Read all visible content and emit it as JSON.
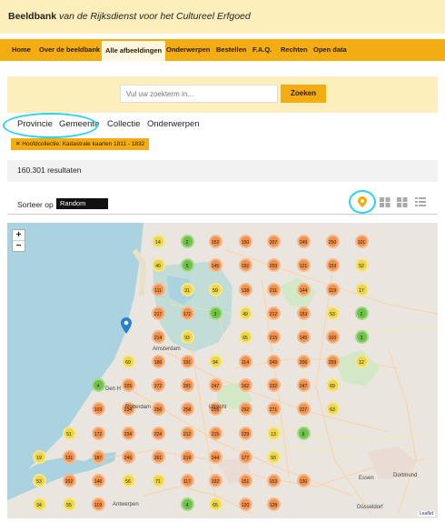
{
  "header": {
    "brand_bold": "Beeldbank",
    "brand_rest": " van de Rijksdienst voor het Cultureel Erfgoed"
  },
  "nav": {
    "items": [
      {
        "label": "Home"
      },
      {
        "label": "Over de beeldbank"
      },
      {
        "label": "Alle afbeeldingen",
        "active": true
      },
      {
        "label": "Onderwerpen"
      },
      {
        "label": "Bestellen"
      },
      {
        "label": "F.A.Q."
      },
      {
        "label": "Rechten"
      },
      {
        "label": "Open data"
      }
    ]
  },
  "search": {
    "placeholder": "Vul uw zoekterm in...",
    "button_label": "Zoeken"
  },
  "facets": [
    "Provincie",
    "Gemeente",
    "Collectie",
    "Onderwerpen"
  ],
  "active_filter": "✕ Hoofdcollectie: Kadastrale kaarten 1811 - 1832",
  "results": {
    "count_text": "160.301 resultaten"
  },
  "sort": {
    "label": "Sorteer op",
    "value": "Random"
  },
  "view_icons": [
    "map-pin-icon",
    "grid-large-icon",
    "grid-small-icon",
    "list-icon"
  ],
  "map": {
    "zoom_in": "+",
    "zoom_out": "−",
    "attribution": "Leaflet",
    "cities": [
      "Amsterdam",
      "Den H",
      "Utrecht",
      "Rotterdam",
      "Antwerpen",
      "Essen",
      "Dortmund",
      "Düsseldorf"
    ],
    "clusters": [
      {
        "label": "14",
        "color": "yellow"
      },
      {
        "label": "2",
        "color": "green"
      },
      {
        "label": "152",
        "color": "orange"
      },
      {
        "label": "150",
        "color": "orange"
      },
      {
        "label": "207",
        "color": "orange"
      },
      {
        "label": "249",
        "color": "orange"
      },
      {
        "label": "250",
        "color": "orange"
      },
      {
        "label": "101",
        "color": "orange"
      },
      {
        "label": "40",
        "color": "yellow"
      },
      {
        "label": "5",
        "color": "green"
      },
      {
        "label": "145",
        "color": "orange"
      },
      {
        "label": "192",
        "color": "orange"
      },
      {
        "label": "203",
        "color": "orange"
      },
      {
        "label": "121",
        "color": "orange"
      },
      {
        "label": "153",
        "color": "orange"
      },
      {
        "label": "52",
        "color": "yellow"
      },
      {
        "label": "111",
        "color": "orange"
      },
      {
        "label": "31",
        "color": "yellow"
      },
      {
        "label": "59",
        "color": "yellow"
      },
      {
        "label": "138",
        "color": "orange"
      },
      {
        "label": "211",
        "color": "orange"
      },
      {
        "label": "144",
        "color": "orange"
      },
      {
        "label": "119",
        "color": "orange"
      },
      {
        "label": "17",
        "color": "yellow"
      },
      {
        "label": "217",
        "color": "orange"
      },
      {
        "label": "172",
        "color": "orange"
      },
      {
        "label": "3",
        "color": "green"
      },
      {
        "label": "49",
        "color": "yellow"
      },
      {
        "label": "212",
        "color": "orange"
      },
      {
        "label": "153",
        "color": "orange"
      },
      {
        "label": "53",
        "color": "yellow"
      },
      {
        "label": "2",
        "color": "green"
      },
      {
        "label": "214",
        "color": "orange"
      },
      {
        "label": "93",
        "color": "yellow"
      },
      {
        "label": "65",
        "color": "yellow"
      },
      {
        "label": "215",
        "color": "orange"
      },
      {
        "label": "145",
        "color": "orange"
      },
      {
        "label": "103",
        "color": "orange"
      },
      {
        "label": "3",
        "color": "green"
      },
      {
        "label": "69",
        "color": "yellow"
      },
      {
        "label": "186",
        "color": "orange"
      },
      {
        "label": "191",
        "color": "orange"
      },
      {
        "label": "94",
        "color": "yellow"
      },
      {
        "label": "114",
        "color": "orange"
      },
      {
        "label": "249",
        "color": "orange"
      },
      {
        "label": "206",
        "color": "orange"
      },
      {
        "label": "259",
        "color": "orange"
      },
      {
        "label": "12",
        "color": "yellow"
      },
      {
        "label": "4",
        "color": "green"
      },
      {
        "label": "225",
        "color": "orange"
      },
      {
        "label": "272",
        "color": "orange"
      },
      {
        "label": "291",
        "color": "orange"
      },
      {
        "label": "247",
        "color": "orange"
      },
      {
        "label": "162",
        "color": "orange"
      },
      {
        "label": "232",
        "color": "orange"
      },
      {
        "label": "247",
        "color": "orange"
      },
      {
        "label": "69",
        "color": "yellow"
      },
      {
        "label": "103",
        "color": "orange"
      },
      {
        "label": "234",
        "color": "orange"
      },
      {
        "label": "256",
        "color": "orange"
      },
      {
        "label": "258",
        "color": "orange"
      },
      {
        "label": "255",
        "color": "orange"
      },
      {
        "label": "292",
        "color": "orange"
      },
      {
        "label": "271",
        "color": "orange"
      },
      {
        "label": "227",
        "color": "orange"
      },
      {
        "label": "63",
        "color": "yellow"
      },
      {
        "label": "51",
        "color": "yellow"
      },
      {
        "label": "172",
        "color": "orange"
      },
      {
        "label": "234",
        "color": "orange"
      },
      {
        "label": "224",
        "color": "orange"
      },
      {
        "label": "212",
        "color": "orange"
      },
      {
        "label": "215",
        "color": "orange"
      },
      {
        "label": "229",
        "color": "orange"
      },
      {
        "label": "13",
        "color": "yellow"
      },
      {
        "label": "6",
        "color": "green"
      },
      {
        "label": "19",
        "color": "yellow"
      },
      {
        "label": "131",
        "color": "orange"
      },
      {
        "label": "187",
        "color": "orange"
      },
      {
        "label": "246",
        "color": "orange"
      },
      {
        "label": "261",
        "color": "orange"
      },
      {
        "label": "219",
        "color": "orange"
      },
      {
        "label": "244",
        "color": "orange"
      },
      {
        "label": "177",
        "color": "orange"
      },
      {
        "label": "93",
        "color": "yellow"
      },
      {
        "label": "53",
        "color": "yellow"
      },
      {
        "label": "202",
        "color": "orange"
      },
      {
        "label": "146",
        "color": "orange"
      },
      {
        "label": "56",
        "color": "yellow"
      },
      {
        "label": "71",
        "color": "yellow"
      },
      {
        "label": "117",
        "color": "orange"
      },
      {
        "label": "192",
        "color": "orange"
      },
      {
        "label": "151",
        "color": "orange"
      },
      {
        "label": "153",
        "color": "orange"
      },
      {
        "label": "130",
        "color": "orange"
      },
      {
        "label": "34",
        "color": "yellow"
      },
      {
        "label": "55",
        "color": "yellow"
      },
      {
        "label": "119",
        "color": "orange"
      },
      {
        "label": "4",
        "color": "green"
      },
      {
        "label": "65",
        "color": "yellow"
      },
      {
        "label": "120",
        "color": "orange"
      },
      {
        "label": "128",
        "color": "orange"
      }
    ]
  }
}
